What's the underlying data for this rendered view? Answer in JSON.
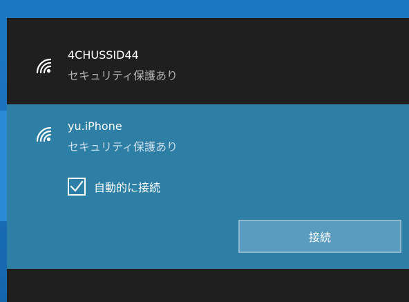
{
  "networks": [
    {
      "name": "4CHUSSID44",
      "status": "セキュリティ保護あり",
      "icon": "wifi-signal-icon"
    },
    {
      "name": "yu.iPhone",
      "status": "セキュリティ保護あり",
      "icon": "wifi-signal-icon",
      "selected": true,
      "auto_connect": {
        "label": "自動的に接続",
        "checked": true
      },
      "connect_label": "接続"
    }
  ],
  "colors": {
    "flyout_bg": "#1f1f1f",
    "selected_bg": "#2e7fa6",
    "button_bg": "#5a9cbf",
    "button_border": "#8fb9cf",
    "desktop_blue": "#1a78c2"
  }
}
